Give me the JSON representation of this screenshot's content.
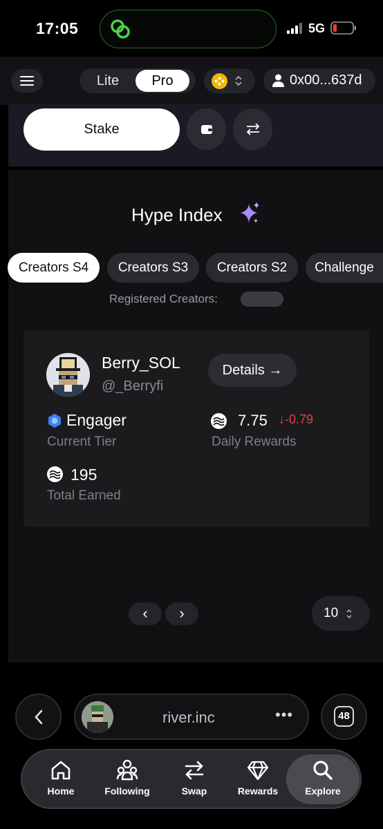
{
  "status_bar": {
    "time": "17:05",
    "network": "5G"
  },
  "header": {
    "mode_lite": "Lite",
    "mode_pro": "Pro",
    "wallet_address": "0x00...637d"
  },
  "actions": {
    "stake_label": "Stake"
  },
  "hype": {
    "title": "Hype Index",
    "tabs": [
      {
        "label": "Creators S4",
        "active": true
      },
      {
        "label": "Creators S3",
        "active": false
      },
      {
        "label": "Creators S2",
        "active": false
      },
      {
        "label": "Challenge",
        "active": false
      }
    ],
    "registered_label": "Registered Creators:"
  },
  "creator": {
    "name": "Berry_SOL",
    "handle": "@_Berryfi",
    "details_label": "Details →",
    "tier_value": "Engager",
    "tier_label": "Current Tier",
    "daily_value": "7.75",
    "daily_change": "↓-0.79",
    "daily_label": "Daily Rewards",
    "earned_value": "195",
    "earned_label": "Total Earned"
  },
  "pagination": {
    "prev": "‹",
    "next": "›",
    "per_page": "10"
  },
  "browser": {
    "url": "river.inc",
    "more": "•••",
    "tab_count": "48"
  },
  "tabbar": {
    "items": [
      {
        "label": "Home",
        "icon": "home-icon"
      },
      {
        "label": "Following",
        "icon": "people-icon"
      },
      {
        "label": "Swap",
        "icon": "swap-icon"
      },
      {
        "label": "Rewards",
        "icon": "diamond-icon"
      },
      {
        "label": "Explore",
        "icon": "search-icon",
        "active": true
      }
    ]
  },
  "colors": {
    "accent_green": "#2f6a2a",
    "negative_red": "#e0453a",
    "tier_blue": "#3b82f6",
    "sparkle_purple": "#a78bfa"
  }
}
